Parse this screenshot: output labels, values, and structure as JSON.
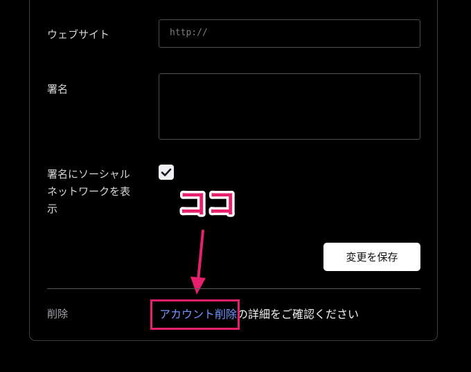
{
  "form": {
    "website_label": "ウェブサイト",
    "website_placeholder": "http://",
    "signature_label": "署名",
    "show_signature_label_1": "署名にソーシャル",
    "show_signature_label_2": "ネットワークを表",
    "show_signature_label_3": "示",
    "show_signature_checked": true,
    "save_label": "変更を保存"
  },
  "delete": {
    "label": "削除",
    "link_text": "アカウント削除",
    "suffix_text": "の詳細をご確認ください"
  },
  "annotation": {
    "callout_text": "ココ",
    "accent_color": "#e6206c"
  }
}
